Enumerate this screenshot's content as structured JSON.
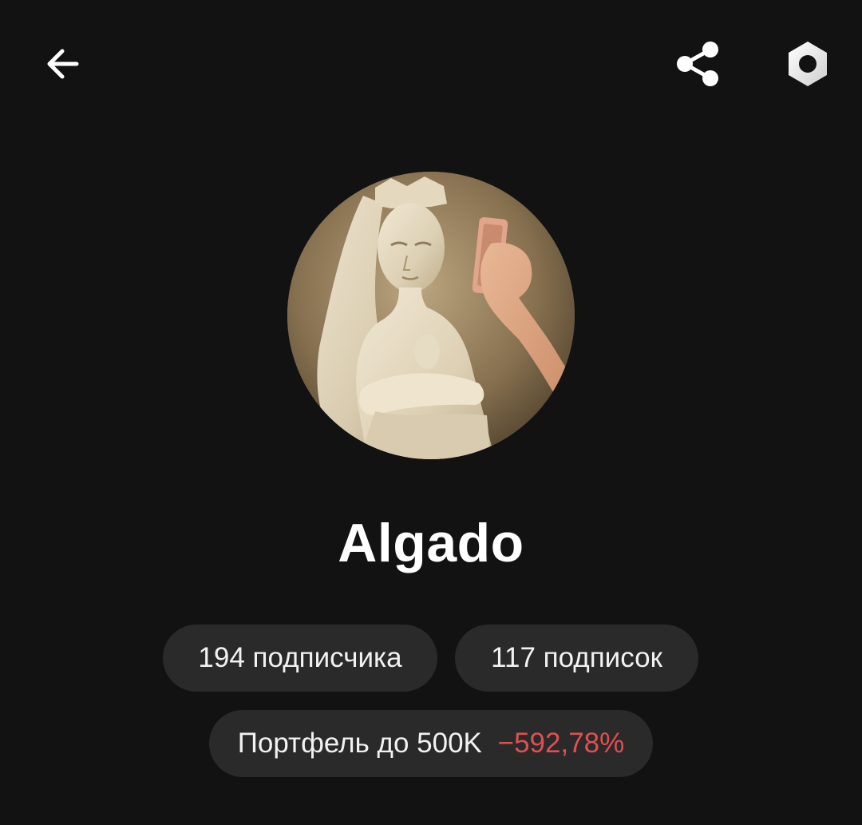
{
  "header": {
    "back_icon": "arrow-left-icon",
    "share_icon": "share-icon",
    "settings_icon": "hexagon-gear-icon"
  },
  "profile": {
    "avatar_description_icon": "avatar-image",
    "username": "Algado"
  },
  "stats": {
    "followers_label": "194 подписчика",
    "following_label": "117 подписок"
  },
  "portfolio": {
    "name": "Портфель до 500K",
    "change": "−592,78%",
    "change_color": "#e0504f"
  },
  "colors": {
    "background": "#121212",
    "pill": "#2a2a2b",
    "text": "#ffffff"
  }
}
